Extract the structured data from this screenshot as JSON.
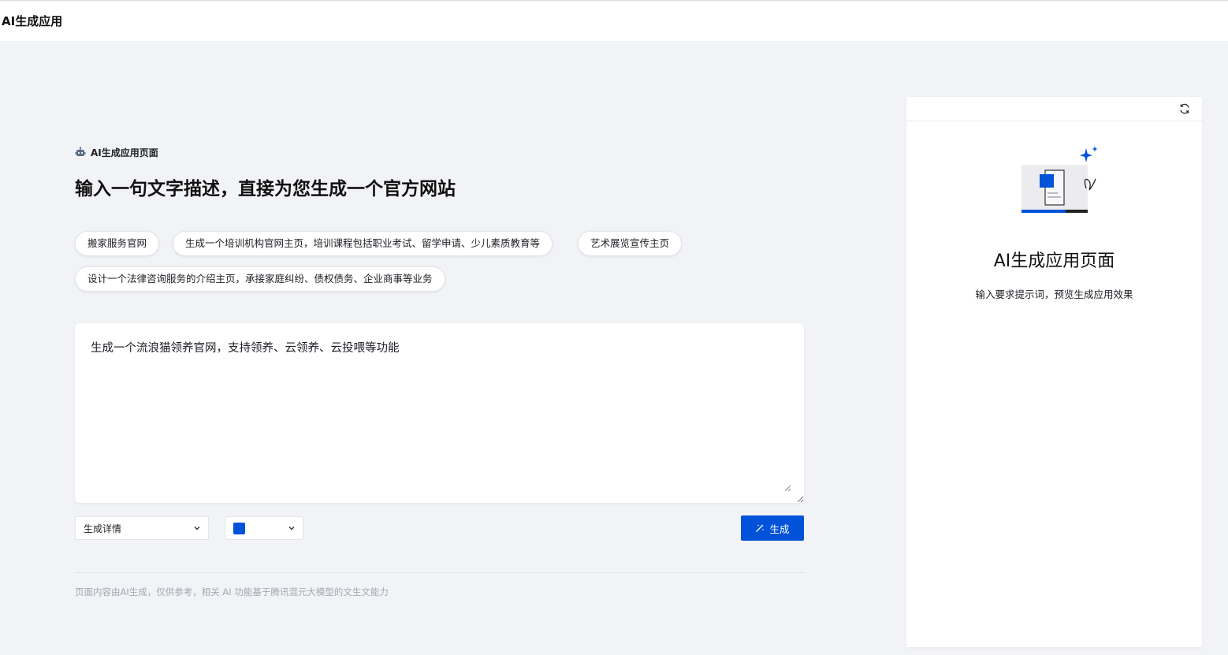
{
  "header": {
    "app_title": "AI生成应用"
  },
  "intro": {
    "eyebrow_label": "AI生成应用页面",
    "headline": "输入一句文字描述，直接为您生成一个官方网站"
  },
  "suggestions": [
    "搬家服务官网",
    "生成一个培训机构官网主页，培训课程包括职业考试、留学申请、少儿素质教育等",
    "艺术展览宣传主页",
    "设计一个法律咨询服务的介绍主页，承接家庭纠纷、债权债务、企业商事等业务"
  ],
  "prompt": {
    "value": "生成一个流浪猫领养官网，支持领养、云领养、云投喂等功能"
  },
  "controls": {
    "mode_select_value": "生成详情",
    "color_select_value": "#0052d9",
    "generate_label": "生成"
  },
  "footer": {
    "disclaimer": "页面内容由AI生成，仅供参考，相关 AI 功能基于腾讯混元大模型的文生文能力"
  },
  "preview": {
    "title": "AI生成应用页面",
    "subtitle": "输入要求提示词，预览生成应用效果"
  },
  "colors": {
    "accent": "#0052d9",
    "page_bg": "#f2f3f6"
  },
  "icons": [
    "robot-icon",
    "chevron-down-icon",
    "magic-wand-icon",
    "refresh-icon",
    "sparkle-icon"
  ]
}
